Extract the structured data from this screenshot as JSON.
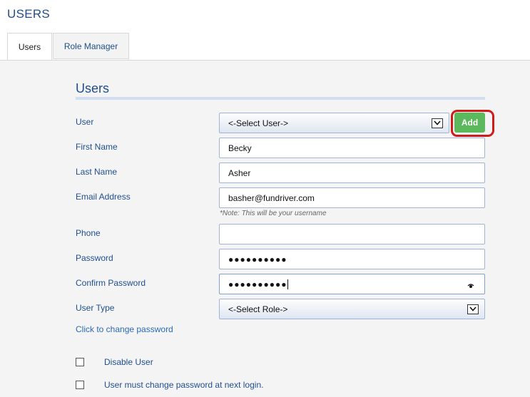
{
  "page": {
    "title": "USERS"
  },
  "tabs": [
    {
      "label": "Users",
      "active": true
    },
    {
      "label": "Role Manager",
      "active": false
    }
  ],
  "section": {
    "title": "Users"
  },
  "form": {
    "user": {
      "label": "User",
      "value": "<-Select User->"
    },
    "add_button": "Add",
    "first_name": {
      "label": "First Name",
      "value": "Becky"
    },
    "last_name": {
      "label": "Last Name",
      "value": "Asher"
    },
    "email": {
      "label": "Email Address",
      "value": "basher@fundriver.com",
      "note": "*Note: This will be your username"
    },
    "phone": {
      "label": "Phone",
      "value": ""
    },
    "password": {
      "label": "Password",
      "value": "●●●●●●●●●●"
    },
    "confirm_password": {
      "label": "Confirm Password",
      "value": "●●●●●●●●●●"
    },
    "user_type": {
      "label": "User Type",
      "value": "<-Select Role->"
    },
    "change_password_link": "Click to change password",
    "disable_user": {
      "label": "Disable User",
      "checked": false
    },
    "must_change": {
      "label": "User must change password at next login.",
      "checked": false
    }
  },
  "colors": {
    "accent": "#1f4f8f",
    "add_button": "#5cb85c",
    "highlight": "#d11a1a"
  }
}
